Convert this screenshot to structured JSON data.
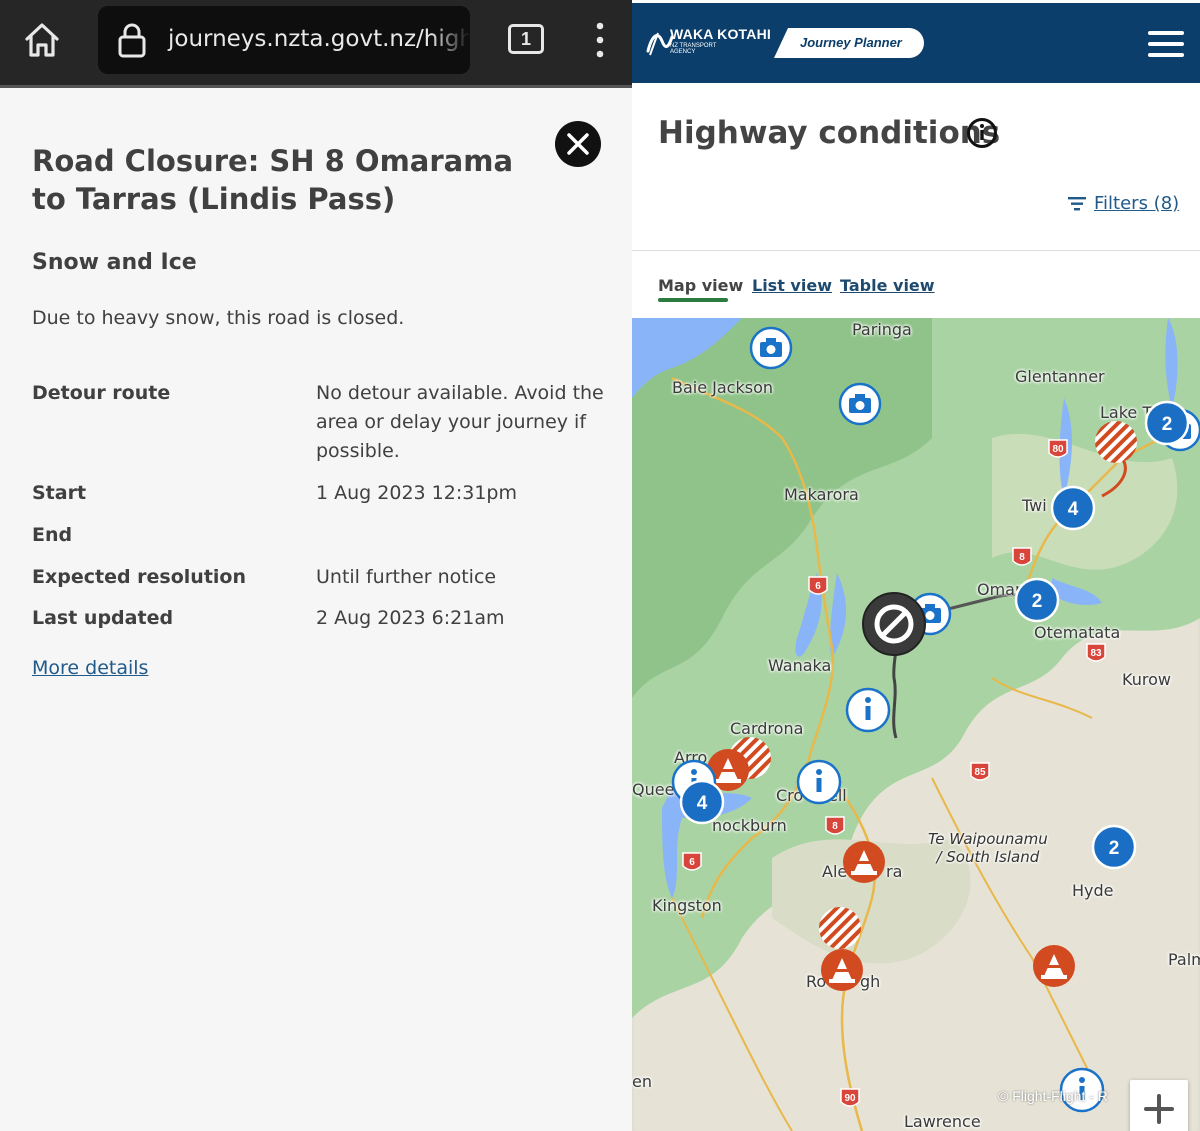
{
  "browser": {
    "url": "journeys.nzta.govt.nz/highways",
    "tab_count": "1"
  },
  "detail": {
    "title": "Road Closure: SH 8 Omarama to Tarras (Lindis Pass)",
    "cause": "Snow and Ice",
    "description": "Due to heavy snow, this road is closed.",
    "rows": [
      {
        "label": "Detour route",
        "value": "No detour available. Avoid the area or delay your journey if possible."
      },
      {
        "label": "Start",
        "value": "1 Aug 2023 12:31pm"
      },
      {
        "label": "End",
        "value": ""
      },
      {
        "label": "Expected resolution",
        "value": "Until further notice"
      },
      {
        "label": "Last updated",
        "value": "2 Aug 2023 6:21am"
      }
    ],
    "more_details": "More details"
  },
  "site": {
    "org_name": "WAKA KOTAHI",
    "org_sub": "NZ TRANSPORT AGENCY",
    "product": "Journey Planner",
    "page_title": "Highway conditions",
    "filters": "Filters (8)",
    "tabs": {
      "map": "Map view",
      "list": "List view",
      "table": "Table view"
    }
  },
  "map": {
    "places": {
      "paringa": "Paringa",
      "baie_jackson": "Baie Jackson",
      "glentanner": "Glentanner",
      "lake_t": "Lake T",
      "makarora": "Makarora",
      "twi": "Twi",
      "omar": "Omar",
      "otematata": "Otematata",
      "wanaka": "Wanaka",
      "kurow": "Kurow",
      "cardrona": "Cardrona",
      "arro": "Arro",
      "queen": "Queen",
      "cro": "Cro",
      "ell": "ell",
      "cromwell_tail": "nockburn",
      "ale": "Ale",
      "ra": "ra",
      "kingston": "Kingston",
      "hyde": "Hyde",
      "ro": "Ro",
      "gh": "gh",
      "palm": "Palm",
      "lawrence": "Lawrence",
      "en": "en",
      "region_1": "Te Waipounamu",
      "region_2": "/ South Island"
    },
    "clusters": {
      "c1": "2",
      "c2": "4",
      "c3": "2",
      "c4": "4",
      "c5": "2"
    },
    "routes": {
      "r80": "80",
      "r8a": "8",
      "r83": "83",
      "r6a": "6",
      "r85": "85",
      "r8b": "8",
      "r6b": "6",
      "r90": "90"
    },
    "copyright": "© Flight-Flight - R"
  }
}
